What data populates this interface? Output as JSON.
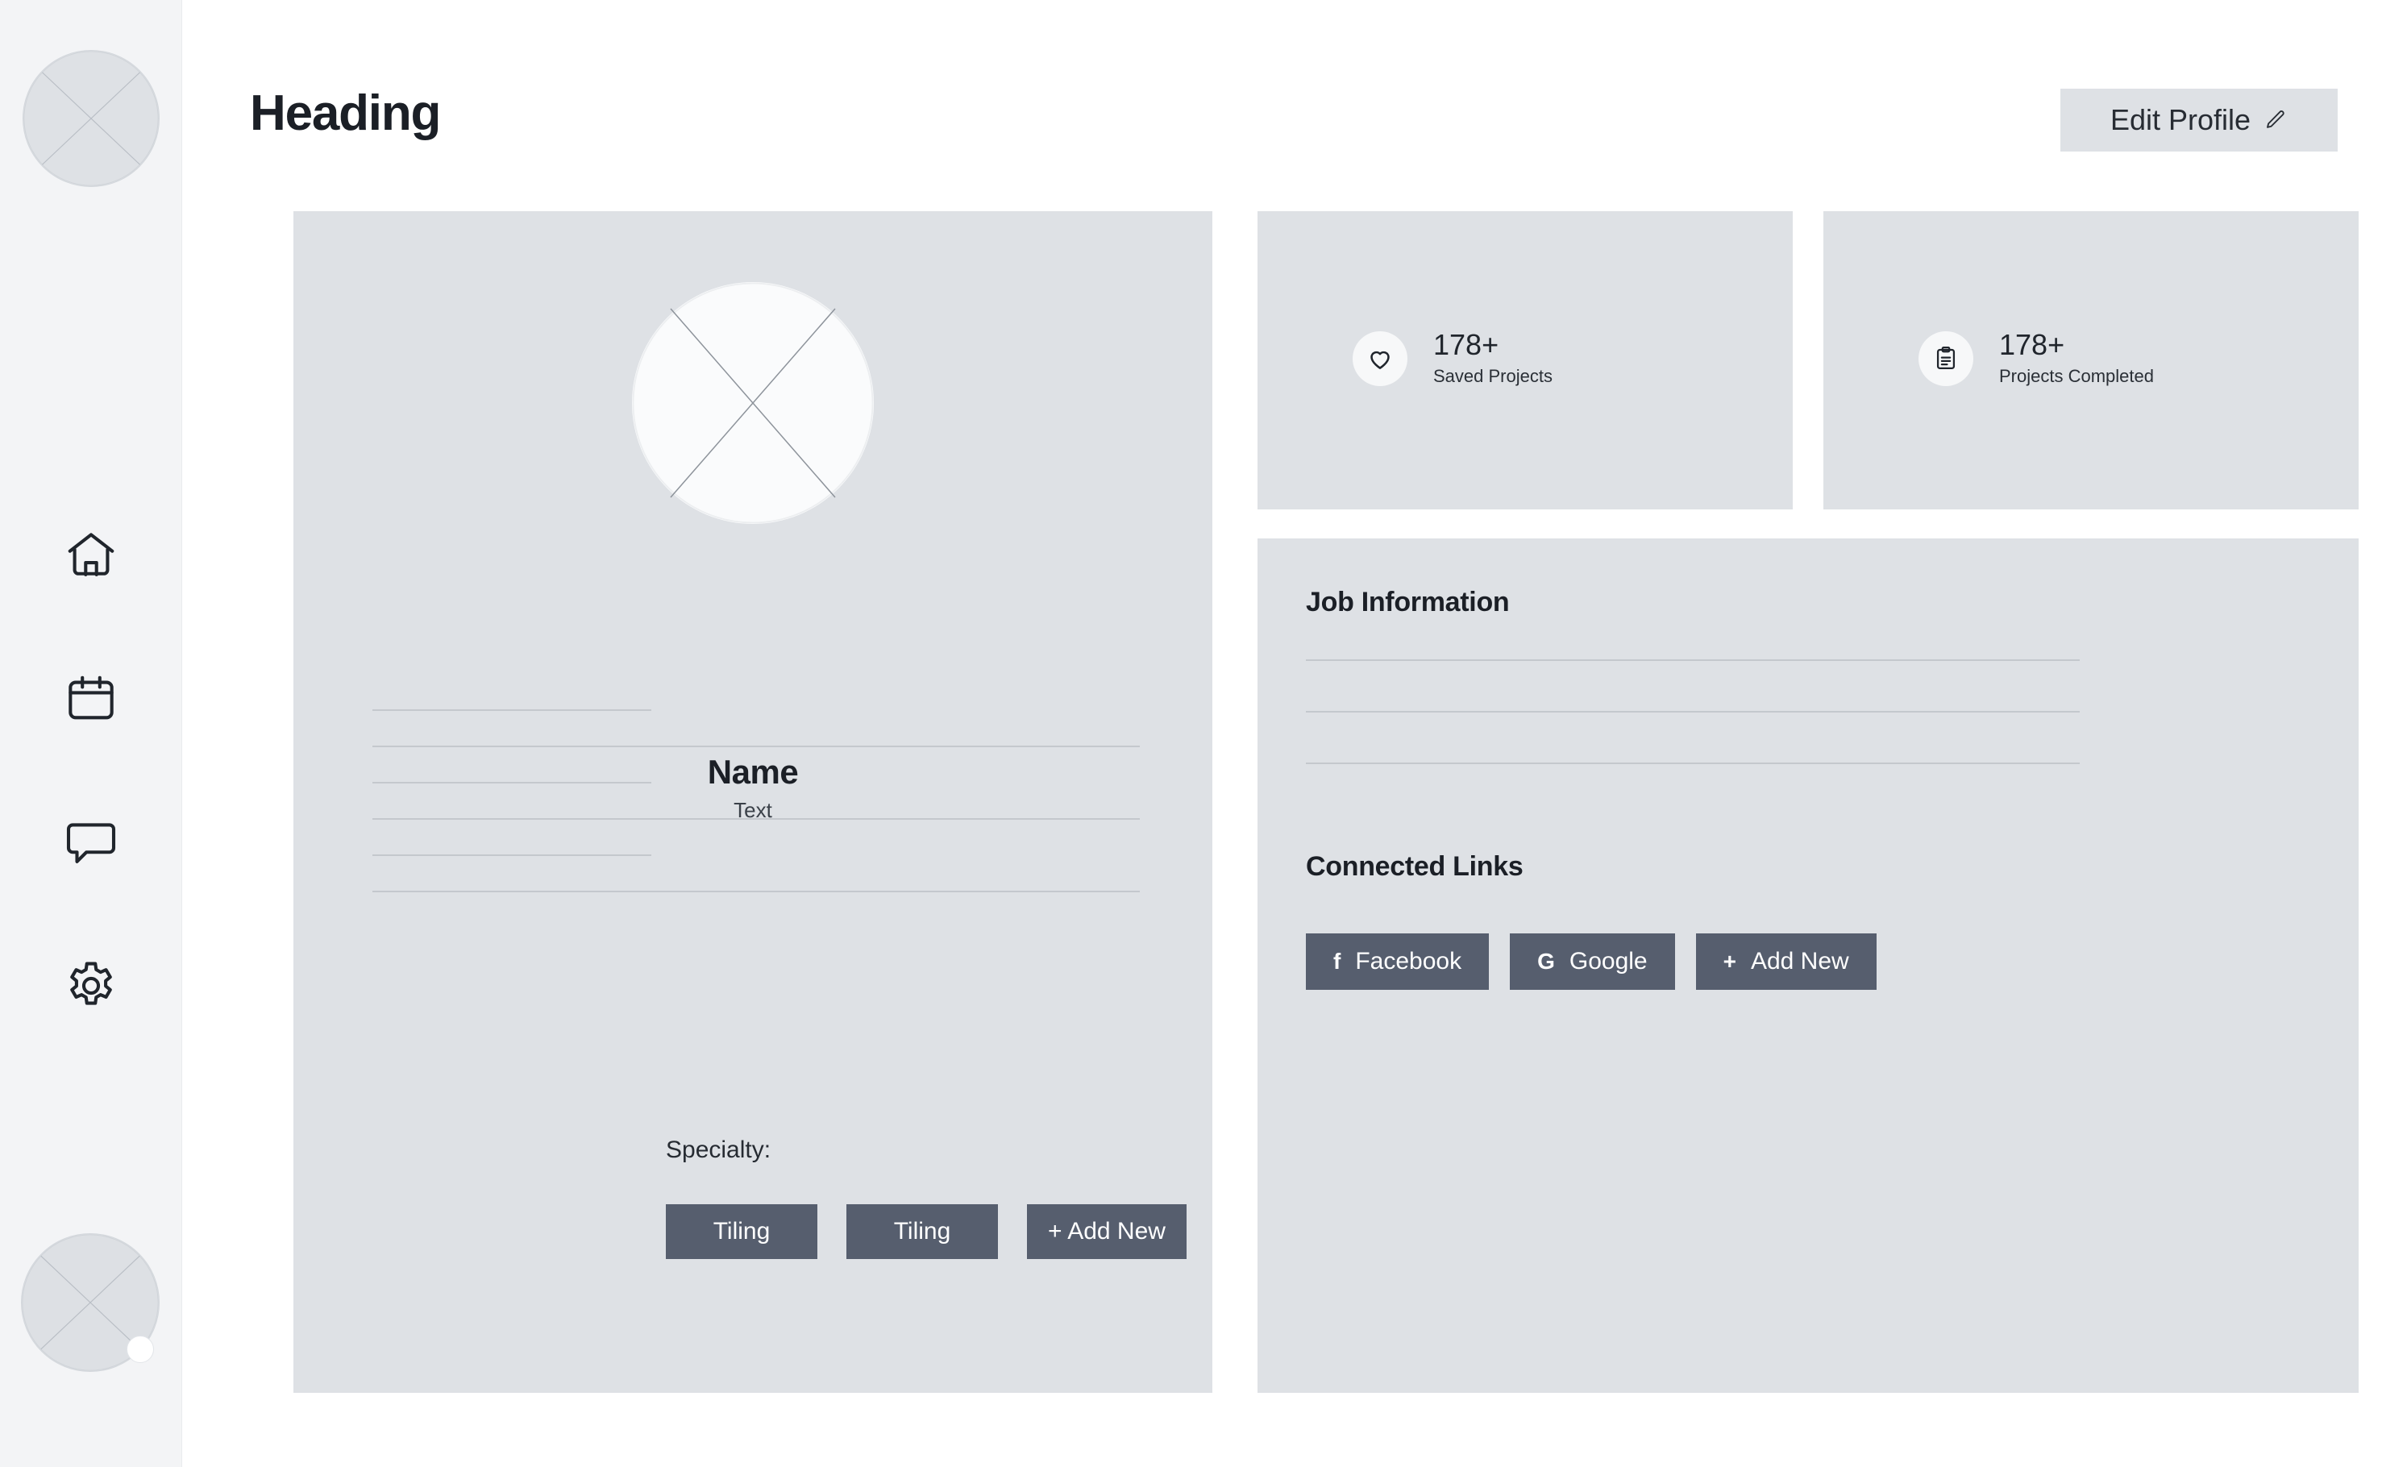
{
  "header": {
    "title": "Heading",
    "edit_profile_label": "Edit Profile",
    "edit_profile_icon": "pencil-icon"
  },
  "sidebar": {
    "top_avatar_icon": "avatar-placeholder-icon",
    "bottom_avatar_icon": "avatar-placeholder-icon",
    "items": [
      {
        "name": "home",
        "icon": "home-icon"
      },
      {
        "name": "calendar",
        "icon": "calendar-icon"
      },
      {
        "name": "messages",
        "icon": "chat-bubble-icon"
      },
      {
        "name": "settings",
        "icon": "gear-icon"
      }
    ]
  },
  "profile": {
    "avatar_icon": "avatar-placeholder-icon",
    "name": "Name",
    "subtitle": "Text",
    "specialty_label": "Specialty:",
    "specialty_tags": [
      "Tiling",
      "Tiling"
    ],
    "add_new_label": "+ Add New",
    "placeholder_lines": 7
  },
  "stats": [
    {
      "icon": "heart-icon",
      "value": "178+",
      "label": "Saved Projects"
    },
    {
      "icon": "clipboard-icon",
      "value": "178+",
      "label": "Projects Completed"
    }
  ],
  "job_information": {
    "title": "Job Information",
    "placeholder_lines": 3
  },
  "connected_links": {
    "title": "Connected Links",
    "buttons": [
      {
        "glyph": "f",
        "label": "Facebook",
        "icon": "facebook-icon"
      },
      {
        "glyph": "G",
        "label": "Google",
        "icon": "google-icon"
      },
      {
        "glyph": "+",
        "label": "Add New",
        "icon": "plus-icon"
      }
    ]
  },
  "colors": {
    "page_background": "#ffffff",
    "sidebar_background": "#f3f4f6",
    "card_background": "#dee1e5",
    "button_dark": "#565e6e",
    "text_dark": "#1b1f26",
    "placeholder_line": "#c4c8cd"
  }
}
